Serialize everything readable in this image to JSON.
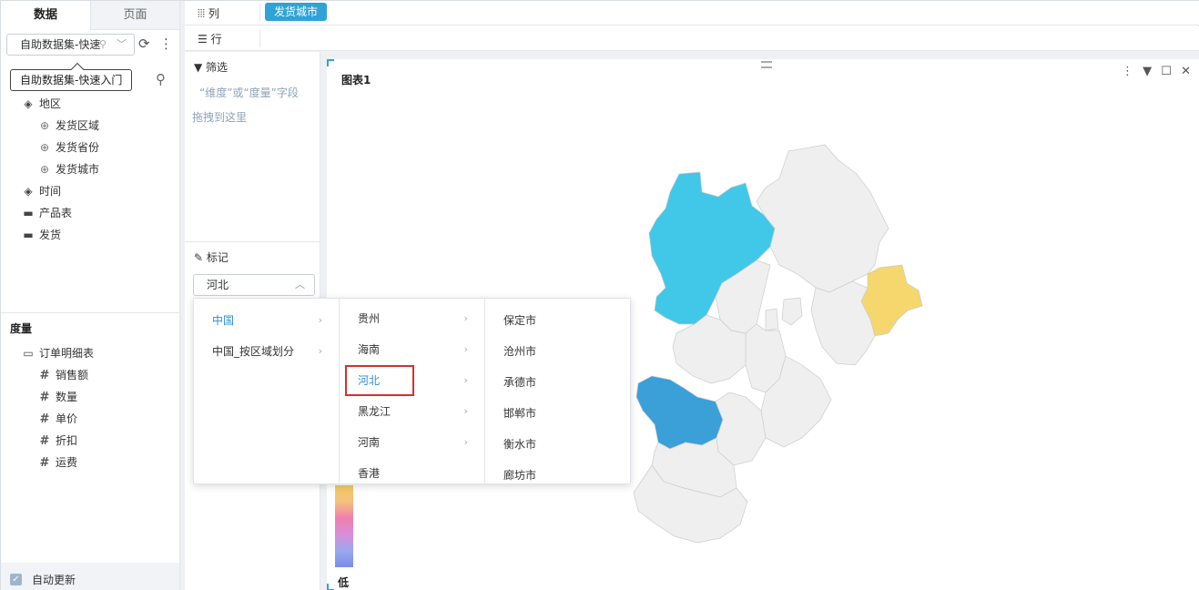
{
  "left_panel": {
    "tabs": [
      "数据",
      "页面"
    ],
    "dataset": {
      "label": "自助数据集-快速",
      "tooltip": "自助数据集-快速入门"
    },
    "dimensions": [
      {
        "label": "地区",
        "icon": "layers-icon"
      },
      {
        "label": "发货区域",
        "icon": "globe-icon"
      },
      {
        "label": "发货省份",
        "icon": "globe-icon"
      },
      {
        "label": "发货城市",
        "icon": "globe-icon"
      },
      {
        "label": "时间",
        "icon": "layers-icon"
      },
      {
        "label": "产品表",
        "icon": "folder-icon"
      },
      {
        "label": "发货",
        "icon": "folder-icon"
      }
    ],
    "measures_title": "度量",
    "measures": [
      {
        "label": "订单明细表",
        "icon": "folder-open-icon"
      },
      {
        "label": "销售额",
        "icon": "hash-bar-icon"
      },
      {
        "label": "数量",
        "icon": "hash-icon"
      },
      {
        "label": "单价",
        "icon": "hash-icon"
      },
      {
        "label": "折扣",
        "icon": "hash-icon"
      },
      {
        "label": "运费",
        "icon": "hash-icon"
      }
    ],
    "auto_update": "自动更新"
  },
  "shelves": {
    "column_label": "列",
    "column_chip": "发货城市",
    "row_label": "行"
  },
  "config": {
    "filter_title": "筛选",
    "filter_hint_1": "“维度”或“度量”字段",
    "filter_hint_2": "拖拽到这里",
    "mark_title": "标记",
    "mark_value": "河北"
  },
  "dropdown": {
    "col1": [
      "中国",
      "中国_按区域划分"
    ],
    "col2": [
      "贵州",
      "海南",
      "河北",
      "黑龙江",
      "河南",
      "香港"
    ],
    "col3": [
      "保定市",
      "沧州市",
      "承德市",
      "邯郸市",
      "衡水市",
      "廊坊市"
    ]
  },
  "chart": {
    "title": "图表1",
    "legend_low": "低",
    "colors": {
      "cyan": "#41c8e8",
      "blue": "#3b9fd8",
      "yellow": "#f5d76e",
      "gray": "#efefef",
      "accent": "#2fa3d5"
    }
  }
}
